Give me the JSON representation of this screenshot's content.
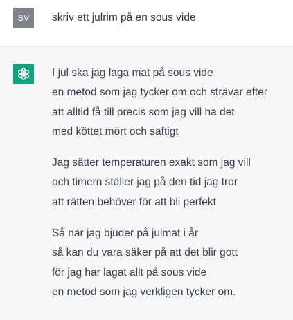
{
  "user": {
    "avatar_initials": "SV",
    "message": "skriv ett julrim på en sous vide"
  },
  "assistant": {
    "avatar_icon": "openai-logo-icon",
    "avatar_color": "#10a37f",
    "stanzas": [
      {
        "lines": [
          "I jul ska jag laga mat på sous vide",
          "en metod som jag tycker om och strävar efter",
          "att alltid få till precis som jag vill ha det",
          "med köttet mört och saftigt"
        ]
      },
      {
        "lines": [
          "Jag sätter temperaturen exakt som jag vill",
          "och timern ställer jag på den tid jag tror",
          "att rätten behöver för att bli perfekt"
        ]
      },
      {
        "lines": [
          "Så när jag bjuder på julmat i år",
          "så kan du vara säker på att det blir gott",
          "för jag har lagat allt på sous vide",
          "en metod som jag verkligen tycker om."
        ]
      }
    ]
  }
}
